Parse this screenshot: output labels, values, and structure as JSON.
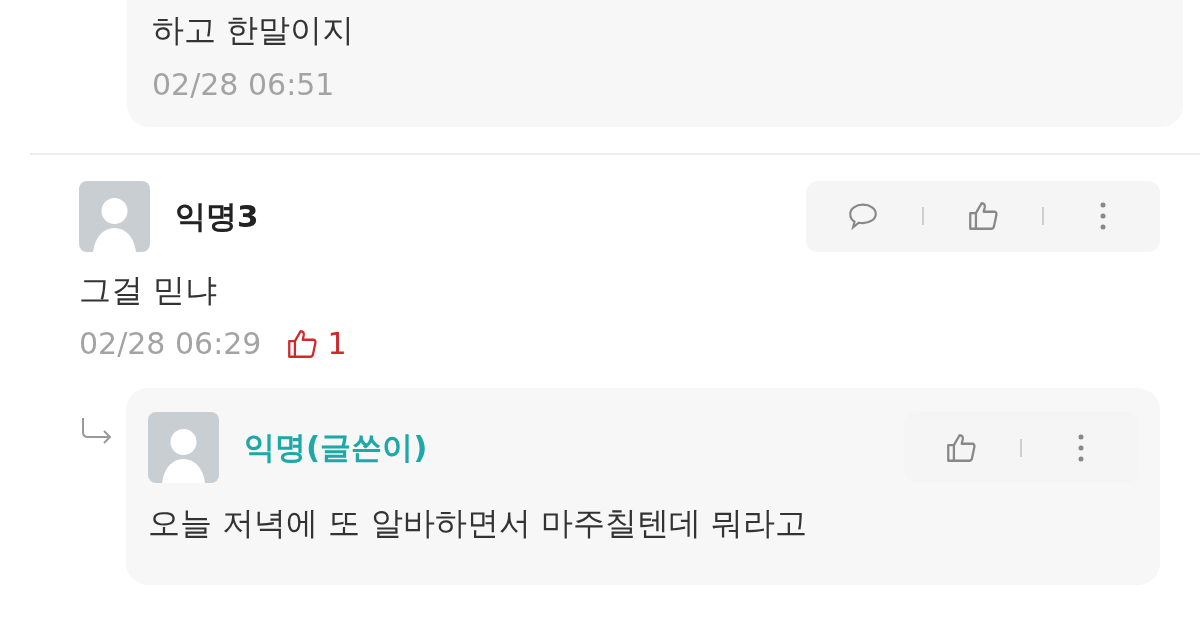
{
  "items": [
    {
      "kind": "reply_tail",
      "text": "하고 한말이지",
      "time": "02/28 06:51"
    },
    {
      "kind": "comment",
      "author": "익명3",
      "is_writer": false,
      "text": "그걸 믿냐",
      "time": "02/28 06:29",
      "likes": "1",
      "actions": [
        {
          "kind": "reply"
        },
        {
          "kind": "like"
        },
        {
          "kind": "more"
        }
      ]
    },
    {
      "kind": "reply",
      "author": "익명(글쓴이)",
      "is_writer": true,
      "text": "오늘 저녁에 또 알바하면서 마주칠텐데 뭐라고",
      "actions": [
        {
          "kind": "like"
        },
        {
          "kind": "more"
        }
      ]
    }
  ]
}
